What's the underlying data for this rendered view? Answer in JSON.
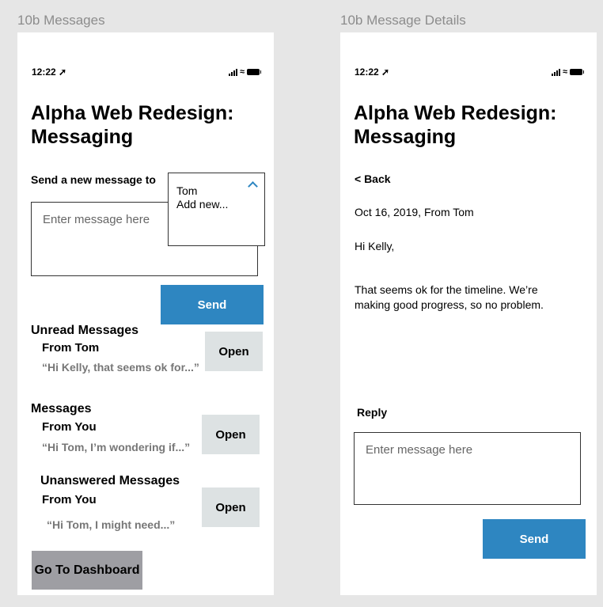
{
  "frames": {
    "left_label": "10b Messages",
    "right_label": "10b Message Details"
  },
  "status_bar": {
    "time": "12:22 ➚"
  },
  "messages_screen": {
    "title": "Alpha Web Redesign: Messaging",
    "send_new_label": "Send a new message to",
    "recipient_dropdown": {
      "options": [
        "Tom",
        "Add new..."
      ]
    },
    "message_input": {
      "placeholder": "Enter message here"
    },
    "send_button": "Send",
    "sections": [
      {
        "heading": "Unread Messages",
        "from": "From Tom",
        "preview": "“Hi Kelly, that seems ok for...”",
        "open_label": "Open"
      },
      {
        "heading": "Messages",
        "from": "From You",
        "preview": "“Hi Tom, I’m wondering if...”",
        "open_label": "Open"
      },
      {
        "heading": "Unanswered Messages",
        "from": "From You",
        "preview": "“Hi Tom, I might need...”",
        "open_label": "Open"
      }
    ],
    "dashboard_button": "Go To Dashboard"
  },
  "details_screen": {
    "title": "Alpha Web Redesign: Messaging",
    "back_link": "< Back",
    "meta": "Oct 16, 2019, From Tom",
    "greeting": "Hi Kelly,",
    "body": "That seems ok for the timeline. We’re making good progress, so no problem.",
    "reply_label": "Reply",
    "reply_input": {
      "placeholder": "Enter message here"
    },
    "send_button": "Send"
  }
}
